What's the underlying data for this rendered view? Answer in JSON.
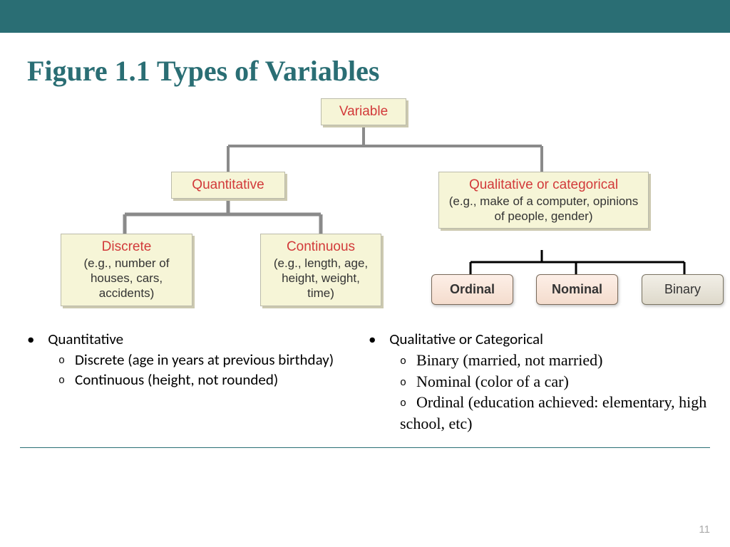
{
  "title": "Figure 1.1 Types of Variables",
  "page_number": "11",
  "tree": {
    "root": {
      "label": "Variable"
    },
    "quant": {
      "label": "Quantitative"
    },
    "qual": {
      "label": "Qualitative or categorical",
      "sub": "(e.g., make of a computer, opinions of people, gender)"
    },
    "discrete": {
      "label": "Discrete",
      "sub": "(e.g., number of houses, cars, accidents)"
    },
    "continuous": {
      "label": "Continuous",
      "sub": "(e.g., length, age, height, weight, time)"
    },
    "ordinal": {
      "label": "Ordinal"
    },
    "nominal": {
      "label": "Nominal"
    },
    "binary": {
      "label": "Binary"
    }
  },
  "bullets": {
    "left": {
      "head": "Quantitative",
      "items": [
        "Discrete (age in years at previous birthday)",
        "Continuous (height, not rounded)"
      ]
    },
    "right": {
      "head": "Qualitative or Categorical",
      "items": [
        "Binary (married, not married)",
        "Nominal (color of a car)",
        "Ordinal (education achieved: elementary, high school, etc)"
      ]
    }
  }
}
